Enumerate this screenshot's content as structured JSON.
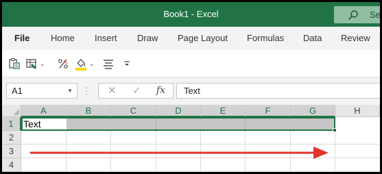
{
  "window": {
    "title": "Book1  -  Excel",
    "search_label": "Se"
  },
  "ribbon": {
    "tabs": [
      {
        "label": "File",
        "active": true
      },
      {
        "label": "Home"
      },
      {
        "label": "Insert"
      },
      {
        "label": "Draw"
      },
      {
        "label": "Page Layout"
      },
      {
        "label": "Formulas"
      },
      {
        "label": "Data"
      },
      {
        "label": "Review"
      }
    ]
  },
  "toolbar": {
    "icons": [
      "paste-special-icon",
      "format-painter-icon",
      "percent-style-icon",
      "fill-color-icon",
      "align-icon",
      "customize-dropdown-icon"
    ],
    "accent_color": "#217346",
    "fill_color": "#ffd700"
  },
  "formula_bar": {
    "name_box": "A1",
    "cancel_glyph": "✕",
    "enter_glyph": "✓",
    "fx_label": "fx",
    "content": "Text"
  },
  "grid": {
    "columns": [
      "A",
      "B",
      "C",
      "D",
      "E",
      "F",
      "G",
      "H"
    ],
    "selected_columns": [
      "A",
      "B",
      "C",
      "D",
      "E",
      "F",
      "G"
    ],
    "rows": [
      "1",
      "2",
      "3",
      "4"
    ],
    "selected_row": "1",
    "active_cell": "A1",
    "selection_range": "A1:G1",
    "cell_a1": "Text",
    "arrow_color": "#e0352b"
  }
}
